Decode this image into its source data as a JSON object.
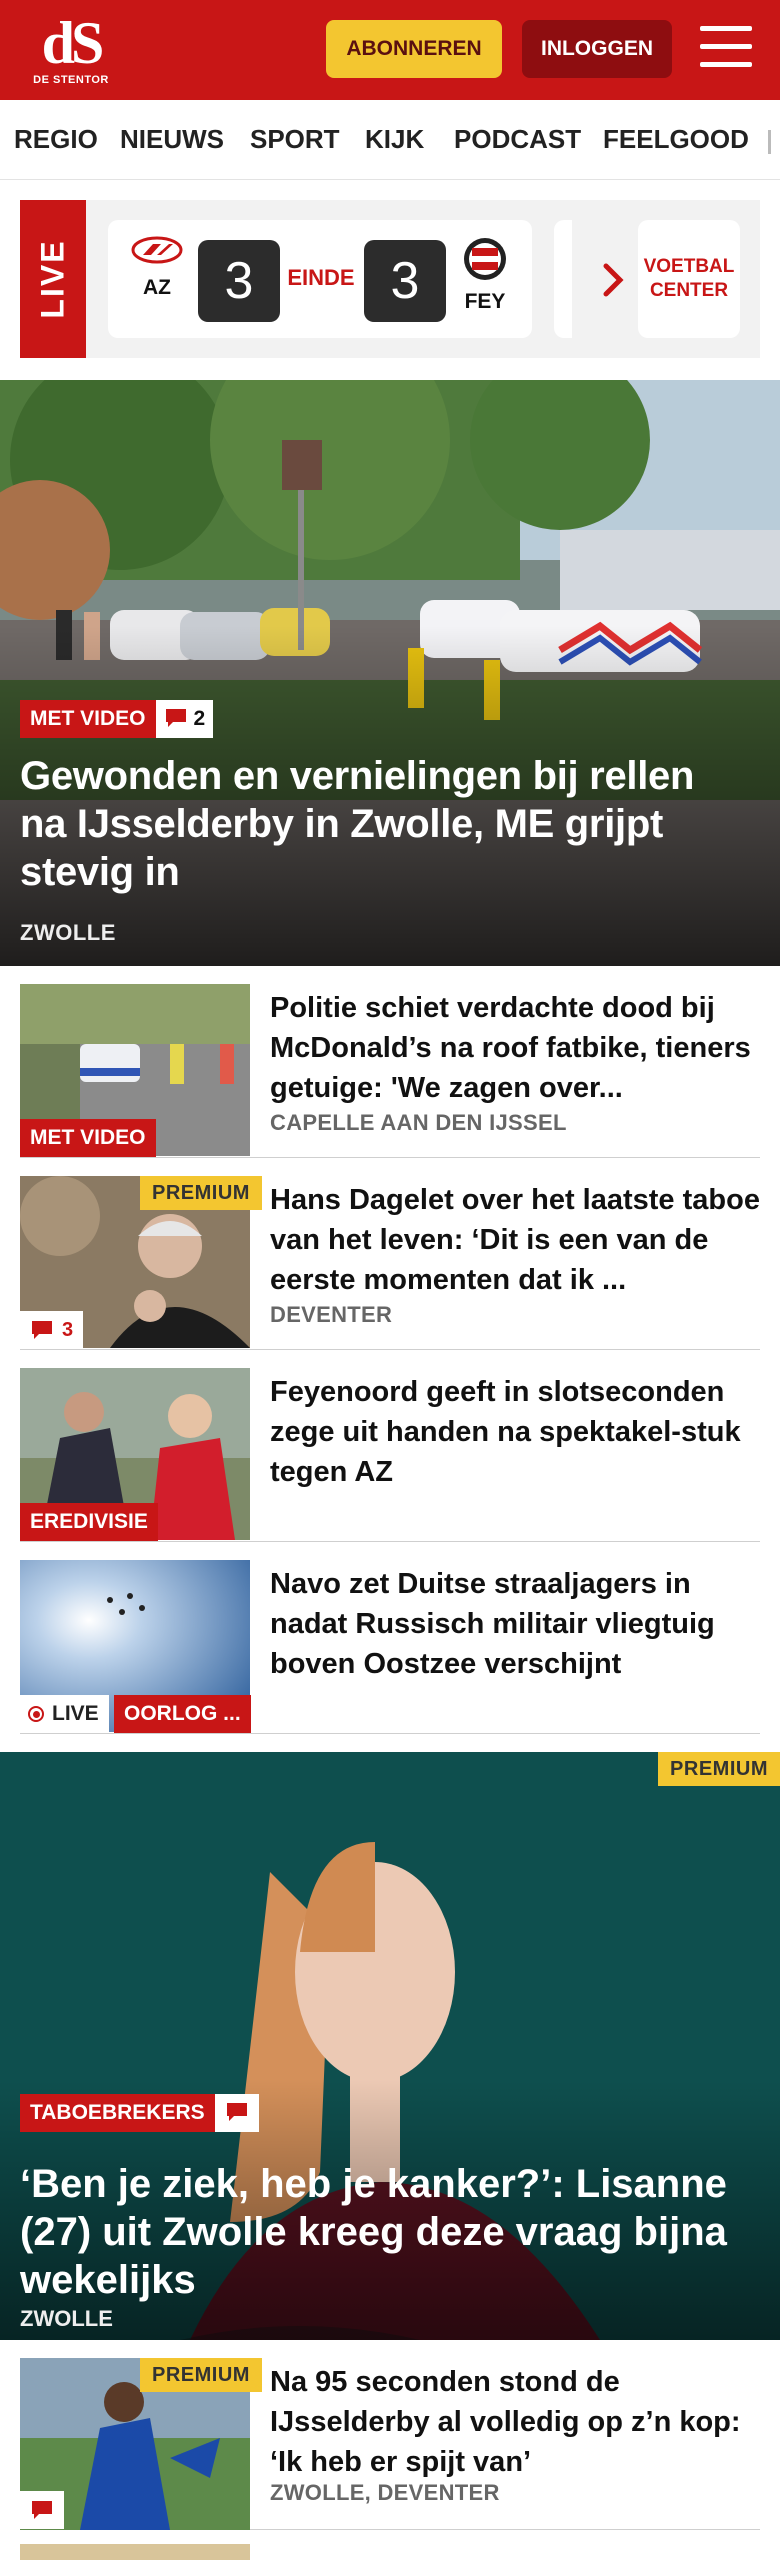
{
  "header": {
    "logo_mark": "dS",
    "logo_sub": "DE STENTOR",
    "subscribe_label": "ABONNEREN",
    "login_label": "INLOGGEN"
  },
  "nav": [
    "REGIO",
    "NIEUWS",
    "SPORT",
    "KIJK",
    "PODCAST",
    "FEELGOOD"
  ],
  "live": {
    "label": "LIVE",
    "home_team": "AZ",
    "away_team": "FEY",
    "home_score": "3",
    "away_score": "3",
    "status": "EINDE",
    "voetbal_center": "VOETBAL CENTER"
  },
  "hero": {
    "badge": "MET VIDEO",
    "comments": "2",
    "title": "Gewonden en vernielingen bij rellen na IJsselderby in Zwolle, ME grijpt stevig in",
    "location": "ZWOLLE"
  },
  "articles": [
    {
      "title": "Politie schiet verdachte dood bij McDonald’s na roof fatbike, tieners getuige: 'We zagen over...",
      "location": "CAPELLE AAN DEN IJSSEL",
      "badge": "MET VIDEO"
    },
    {
      "title": "Hans Dagelet over het laatste taboe van het leven: ‘Dit is een van de eerste momenten dat ik ...",
      "location": "DEVENTER",
      "premium": "PREMIUM",
      "comments": "3"
    },
    {
      "title": "Feyenoord geeft in slotseconden zege uit handen na spektakel-stuk tegen AZ",
      "location": "",
      "badge": "EREDIVISIE"
    },
    {
      "title": "Navo zet Duitse straaljagers in nadat Russisch militair vliegtuig boven Oostzee verschijnt",
      "location": "",
      "live_label": "LIVE",
      "badge": "OORLOG ..."
    }
  ],
  "feature": {
    "premium": "PREMIUM",
    "badge": "TABOEBREKERS",
    "title": "‘Ben je ziek, heb je kanker?’: Lisanne (27) uit Zwolle kreeg deze vraag bijna wekelijks",
    "location": "ZWOLLE"
  },
  "article_bottom": {
    "premium": "PREMIUM",
    "title": "Na 95 seconden stond de IJsselderby al volledig op z’n kop: ‘Ik heb er spijt van’",
    "location": "ZWOLLE, DEVENTER"
  },
  "colors": {
    "brand_red": "#c81616",
    "premium_yellow": "#f3c630",
    "login_dark_red": "#8e0d10"
  }
}
